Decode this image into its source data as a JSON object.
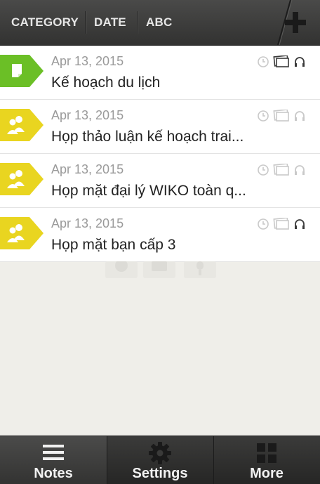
{
  "toolbar": {
    "sort_tabs": [
      "CATEGORY",
      "DATE",
      "ABC"
    ],
    "add_icon": "plus-icon"
  },
  "notes": [
    {
      "date": "Apr 13, 2015",
      "title": "Kế hoạch du lịch",
      "category_icon": "note-icon",
      "tag_color": "#6bbf26",
      "icons_active": {
        "clock": false,
        "photo": true,
        "audio": true
      }
    },
    {
      "date": "Apr 13, 2015",
      "title": "Họp thảo luận kế hoạch trai...",
      "category_icon": "people-icon",
      "tag_color": "#e9d520",
      "icons_active": {
        "clock": false,
        "photo": false,
        "audio": false
      }
    },
    {
      "date": "Apr 13, 2015",
      "title": "Họp mặt đại lý WIKO toàn q...",
      "category_icon": "people-icon",
      "tag_color": "#e9d520",
      "icons_active": {
        "clock": false,
        "photo": false,
        "audio": false
      }
    },
    {
      "date": "Apr 13, 2015",
      "title": "Họp mặt bạn cấp 3",
      "category_icon": "people-icon",
      "tag_color": "#e9d520",
      "icons_active": {
        "clock": false,
        "photo": false,
        "audio": true
      }
    }
  ],
  "tabbar": {
    "tabs": [
      {
        "label": "Notes",
        "icon": "list-icon",
        "active": true
      },
      {
        "label": "Settings",
        "icon": "gear-icon",
        "active": false
      },
      {
        "label": "More",
        "icon": "grid-icon",
        "active": false
      }
    ]
  },
  "colors": {
    "green_tag": "#6bbf26",
    "yellow_tag": "#e9d520",
    "active_icon": "#3a3a3a",
    "inactive_icon": "#c9c9c9"
  }
}
